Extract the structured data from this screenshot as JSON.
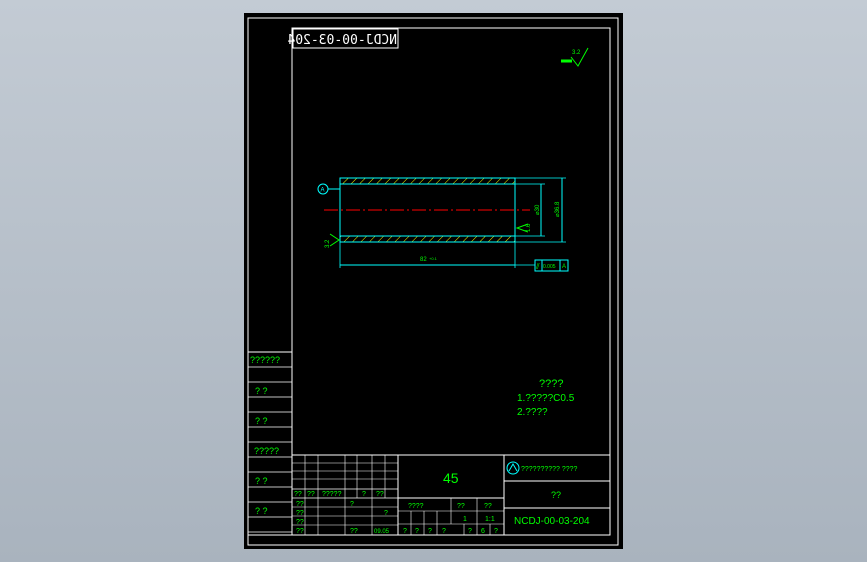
{
  "drawing": {
    "mirrored_code": "NCDJ-00-03-204",
    "roughness_symbol": "3.2",
    "datum_label": "A",
    "dim_inner": "⌀30",
    "dim_outer": "⌀36.8",
    "dim_length": "82",
    "dim_length_tol": "+0.1",
    "roughness_inner": "1.6",
    "roughness_outer": "3.2",
    "gdt_symbol": "⫽",
    "gdt_value": "0.005",
    "gdt_datum": "A"
  },
  "notes": {
    "title": "????",
    "line1": "1.?????C0.5",
    "line2": "2.????"
  },
  "side_table": [
    "??????",
    "?  ?",
    "?  ?",
    "?????",
    "?  ?",
    "?  ?"
  ],
  "title_block": {
    "material": "45",
    "company": "?????????? ????",
    "part_name": "??",
    "drawing_no": "NCDJ-00-03-204",
    "sign_row": [
      "??",
      "??",
      "?????",
      "?",
      "??"
    ],
    "grid_rows": [
      [
        "??",
        "",
        "?",
        ""
      ],
      [
        "??",
        "",
        "",
        "?"
      ],
      [
        "??",
        "",
        "",
        ""
      ],
      [
        "??",
        "",
        "??",
        "09.05"
      ]
    ],
    "scale_header": [
      "????",
      "??",
      "??"
    ],
    "scale_values": [
      "",
      "1",
      "1:1"
    ],
    "bottom_row": [
      "?",
      "?",
      "?",
      "?",
      "?",
      "6",
      "?"
    ]
  },
  "colors": {
    "background": "#000000",
    "line": "#00ffff",
    "text": "#00ff00",
    "center": "#ff0000",
    "hatch": "#ffff00",
    "white": "#ffffff"
  }
}
